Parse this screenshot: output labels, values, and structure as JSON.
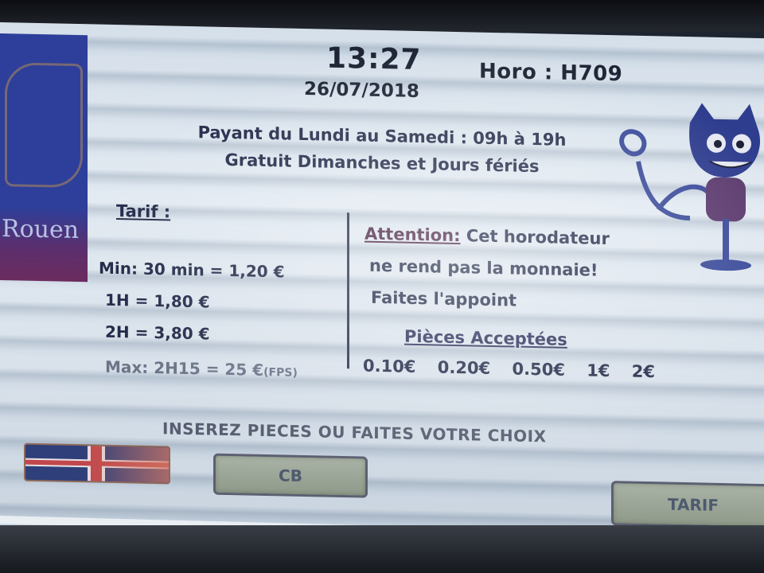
{
  "header": {
    "time": "13:27",
    "date": "26/07/2018",
    "horo_id": "Horo : H709"
  },
  "crest": {
    "city": "Rouen"
  },
  "schedule": {
    "line1": "Payant du Lundi au Samedi : 09h à 19h",
    "line2": "Gratuit Dimanches et Jours fériés"
  },
  "tarif": {
    "title": "Tarif :",
    "rows": [
      "Min: 30 min = 1,20 €",
      "1H = 1,80 €",
      "2H = 3,80 €",
      "Max: 2H15 = 25 €"
    ],
    "fps_note": "(FPS)"
  },
  "attention": {
    "label": "Attention:",
    "line1": "Cet horodateur",
    "line2": "ne rend pas la monnaie!",
    "line3": "Faites l'appoint"
  },
  "coins": {
    "title": "Pièces Acceptées",
    "values": [
      "0.10€",
      "0.20€",
      "0.50€",
      "1€",
      "2€"
    ]
  },
  "instruction": "INSEREZ PIECES OU FAITES VOTRE CHOIX",
  "buttons": {
    "cb_label": "CB",
    "tarif_label": "TARIF",
    "language_flag": "uk-flag-icon"
  },
  "colors": {
    "text_dark": "#242c4a",
    "crest_blue": "#2d3f9a",
    "button_bg": "#9aa495"
  }
}
